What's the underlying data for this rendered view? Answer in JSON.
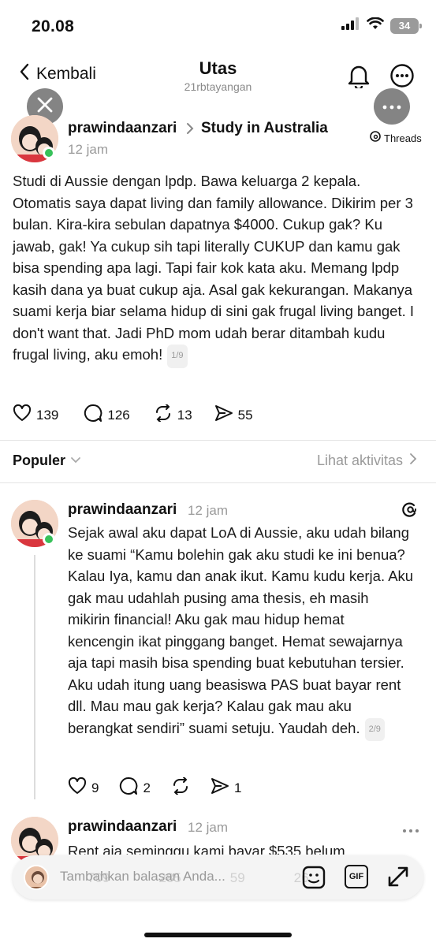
{
  "status_bar": {
    "time": "20.08",
    "battery": "34"
  },
  "nav": {
    "back_label": "Kembali",
    "title": "Utas",
    "subtitle": "21rbtayangan"
  },
  "main_post": {
    "username": "prawindaanzari",
    "community": "Study in Australia",
    "time": "12 jam",
    "badge": "Threads",
    "text": "Studi di Aussie dengan lpdp. Bawa keluarga 2 kepala. Otomatis saya dapat living dan family allowance. Dikirim per 3 bulan. Kira-kira sebulan dapatnya $4000. Cukup gak? Ku jawab, gak! Ya cukup sih tapi literally CUKUP dan kamu gak bisa spending apa lagi. Tapi fair kok kata aku. Memang lpdp kasih dana ya buat cukup aja. Asal gak kekurangan. Makanya suami kerja biar selama hidup di sini gak frugal living banget. I don't want that. Jadi PhD mom udah berar ditambah kudu frugal living, aku emoh!",
    "counter": "1/9",
    "likes": "139",
    "comments": "126",
    "reposts": "13",
    "shares": "55"
  },
  "sort": {
    "label": "Populer",
    "activity": "Lihat aktivitas"
  },
  "reply_1": {
    "username": "prawindaanzari",
    "time": "12 jam",
    "text": "Sejak awal aku dapat LoA di Aussie, aku udah bilang ke suami “Kamu bolehin gak aku studi ke ini benua? Kalau Iya, kamu dan anak ikut. Kamu kudu kerja. Aku gak mau udahlah pusing ama thesis, eh masih mikirin financial! Aku gak mau hidup hemat kencengin ikat pinggang banget. Hemat sewajarnya aja tapi masih bisa spending buat kebutuhan tersier. Aku udah itung uang beasiswa PAS buat bayar rent dll. Mau mau gak kerja? Kalau gak mau aku berangkat sendiri” suami setuju. Yaudah deh.",
    "counter": "2/9",
    "likes": "9",
    "comments": "2",
    "shares": "1"
  },
  "reply_2": {
    "username": "prawindaanzari",
    "time": "12 jam",
    "text_partial": "Rent aja seminggu kami bayar $535 belum"
  },
  "reply_box": {
    "placeholder": "Tambahkan balasan Anda...",
    "gif_label": "GIF",
    "behind_counts": [
      "709",
      "285",
      "59",
      "26"
    ]
  }
}
